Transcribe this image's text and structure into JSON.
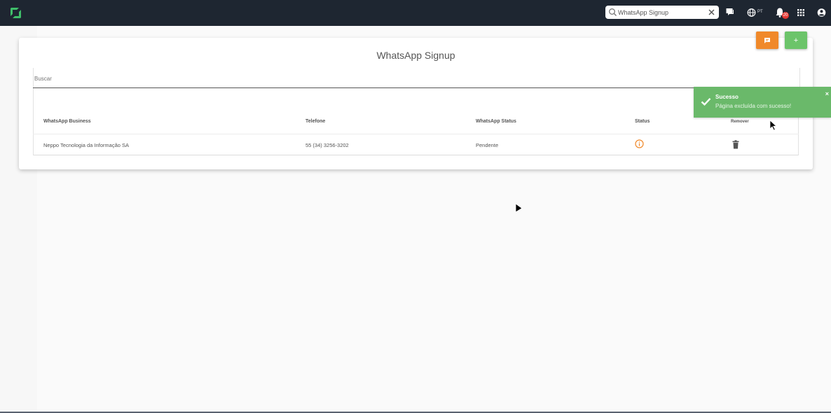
{
  "header": {
    "search": {
      "value": "WhatsApp Signup",
      "placeholder": ""
    },
    "language": "PT",
    "notification_count": "20"
  },
  "page": {
    "title": "WhatsApp Signup",
    "search_placeholder": "Buscar"
  },
  "table": {
    "columns": [
      "WhatsApp Business",
      "Telefone",
      "WhatsApp Status",
      "Status",
      "Remover"
    ],
    "rows": [
      {
        "business": "Neppo Tecnologia da Informação SA",
        "phone": "55 (34) 3256-3202",
        "whatsapp_status": "Pendente",
        "status_icon": "info-icon",
        "remove_icon": "trash-icon"
      }
    ]
  },
  "toast": {
    "title": "Sucesso",
    "message": "Página excluída com sucesso!",
    "close": "×"
  },
  "fab": {
    "add_label": "+"
  },
  "colors": {
    "topbar": "#1e2631",
    "accent_green": "#6cc46a",
    "accent_orange": "#f0892a",
    "toast_bg": "#6ab96a",
    "logo_green": "#3fbf6a"
  }
}
